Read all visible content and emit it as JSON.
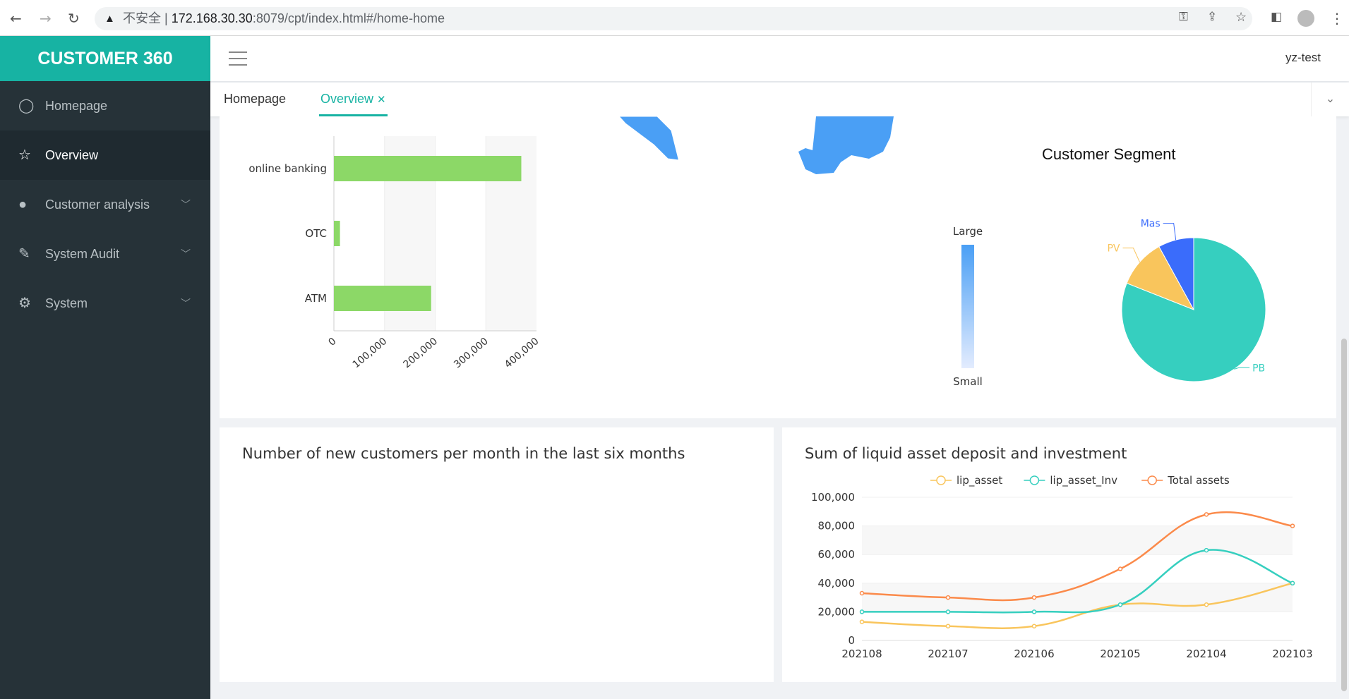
{
  "browser": {
    "security": "不安全",
    "url_host": "172.168.30.30",
    "url_rest": ":8079/cpt/index.html#/home-home"
  },
  "app": {
    "logo": "CUSTOMER 360",
    "user": "yz-test"
  },
  "sidebar": {
    "items": [
      {
        "label": "Homepage",
        "icon": "user-circle-icon",
        "active": false,
        "expandable": false
      },
      {
        "label": "Overview",
        "icon": "star-icon",
        "active": true,
        "expandable": false
      },
      {
        "label": "Customer analysis",
        "icon": "person-icon",
        "active": false,
        "expandable": true
      },
      {
        "label": "System Audit",
        "icon": "edit-icon",
        "active": false,
        "expandable": true
      },
      {
        "label": "System",
        "icon": "gear-icon",
        "active": false,
        "expandable": true
      }
    ]
  },
  "tabs": [
    {
      "label": "Homepage",
      "active": false
    },
    {
      "label": "Overview",
      "active": true,
      "closable": true
    }
  ],
  "colors": {
    "accent": "#17b3a3",
    "sidebar": "#263238",
    "bar": "#8cd867",
    "map": "#4a9ff5"
  },
  "chart_data": [
    {
      "type": "bar",
      "orientation": "horizontal",
      "categories": [
        "online banking",
        "OTC",
        "ATM"
      ],
      "values": [
        370000,
        12000,
        192000
      ],
      "xlim": [
        0,
        400000
      ],
      "xticks": [
        "0",
        "100,000",
        "200,000",
        "300,000",
        "400,000"
      ],
      "grid": true
    },
    {
      "type": "pie",
      "title": "Customer Segment",
      "slices": [
        {
          "name": "PB",
          "value": 81,
          "color": "#36cfbf"
        },
        {
          "name": "PV",
          "value": 11,
          "color": "#f9c55c"
        },
        {
          "name": "Mas",
          "value": 8,
          "color": "#3a6cfb"
        }
      ],
      "visual_map": {
        "high": "Large",
        "low": "Small"
      }
    },
    {
      "type": "line",
      "title": "Number of new customers per month in the last six months",
      "series": []
    },
    {
      "type": "line",
      "title": "Sum of liquid asset deposit and investment",
      "categories": [
        "202108",
        "202107",
        "202106",
        "202105",
        "202104",
        "202103"
      ],
      "ylim": [
        0,
        100000
      ],
      "yticks": [
        "0",
        "20,000",
        "40,000",
        "60,000",
        "80,000",
        "100,000"
      ],
      "legend": "top-center",
      "smooth": true,
      "series": [
        {
          "name": "lip_asset",
          "color": "#f9c55c",
          "values": [
            13000,
            10000,
            10000,
            25000,
            25000,
            40000
          ]
        },
        {
          "name": "lip_asset_Inv",
          "color": "#36cfbf",
          "values": [
            20000,
            20000,
            20000,
            25000,
            63000,
            40000
          ]
        },
        {
          "name": "Total assets",
          "color": "#fb8a4a",
          "values": [
            33000,
            30000,
            30000,
            50000,
            88000,
            80000
          ]
        }
      ]
    }
  ]
}
